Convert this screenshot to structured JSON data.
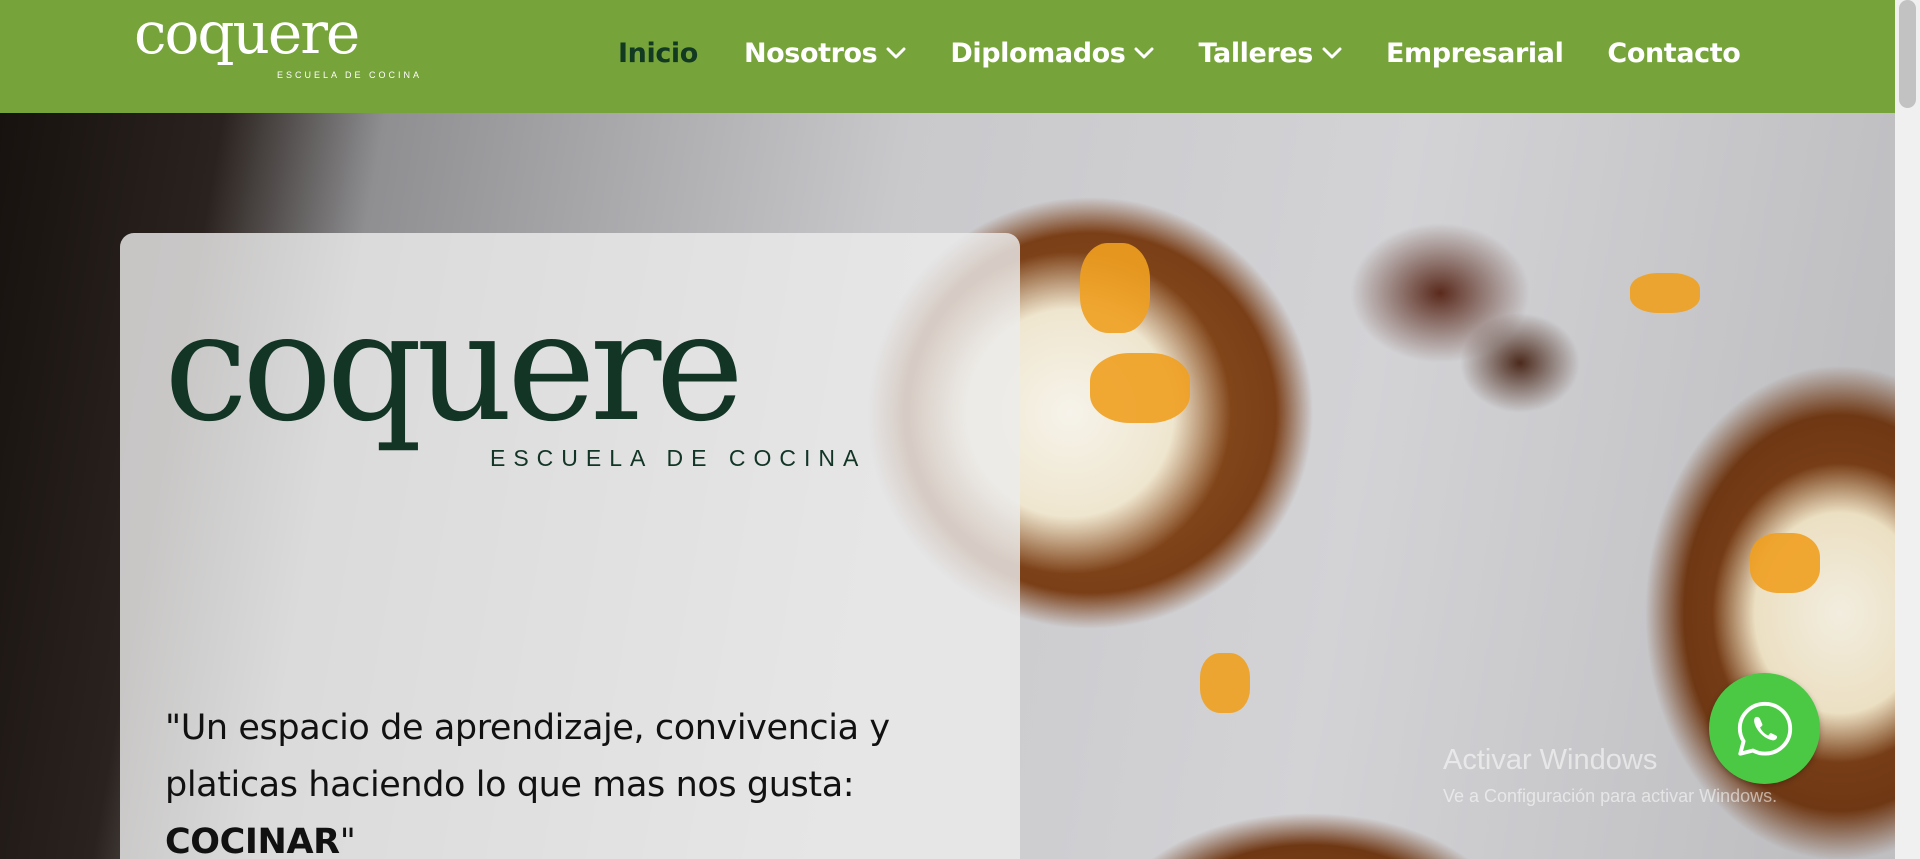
{
  "header": {
    "brand": {
      "name": "coquere",
      "tagline": "ESCUELA DE COCINA"
    },
    "nav": [
      {
        "label": "Inicio",
        "active": true,
        "dropdown": false
      },
      {
        "label": "Nosotros",
        "active": false,
        "dropdown": true
      },
      {
        "label": "Diplomados",
        "active": false,
        "dropdown": true
      },
      {
        "label": "Talleres",
        "active": false,
        "dropdown": true
      },
      {
        "label": "Empresarial",
        "active": false,
        "dropdown": false
      },
      {
        "label": "Contacto",
        "active": false,
        "dropdown": false
      }
    ]
  },
  "hero": {
    "logo": {
      "name": "coquere",
      "tagline": "ESCUELA DE COCINA"
    },
    "quote_text": "\"Un espacio de aprendizaje, convivencia y platicas haciendo lo que mas nos gusta: ",
    "quote_strong": "COCINAR",
    "quote_end": "\""
  },
  "windows_watermark": {
    "title": "Activar Windows",
    "subtitle": "Ve a Configuración para activar Windows."
  },
  "whatsapp": {
    "icon": "whatsapp-icon"
  },
  "colors": {
    "header_bg": "#76a33a",
    "active_nav": "#123a22",
    "logo_dark": "#123526",
    "whatsapp_green": "#4bc945"
  }
}
